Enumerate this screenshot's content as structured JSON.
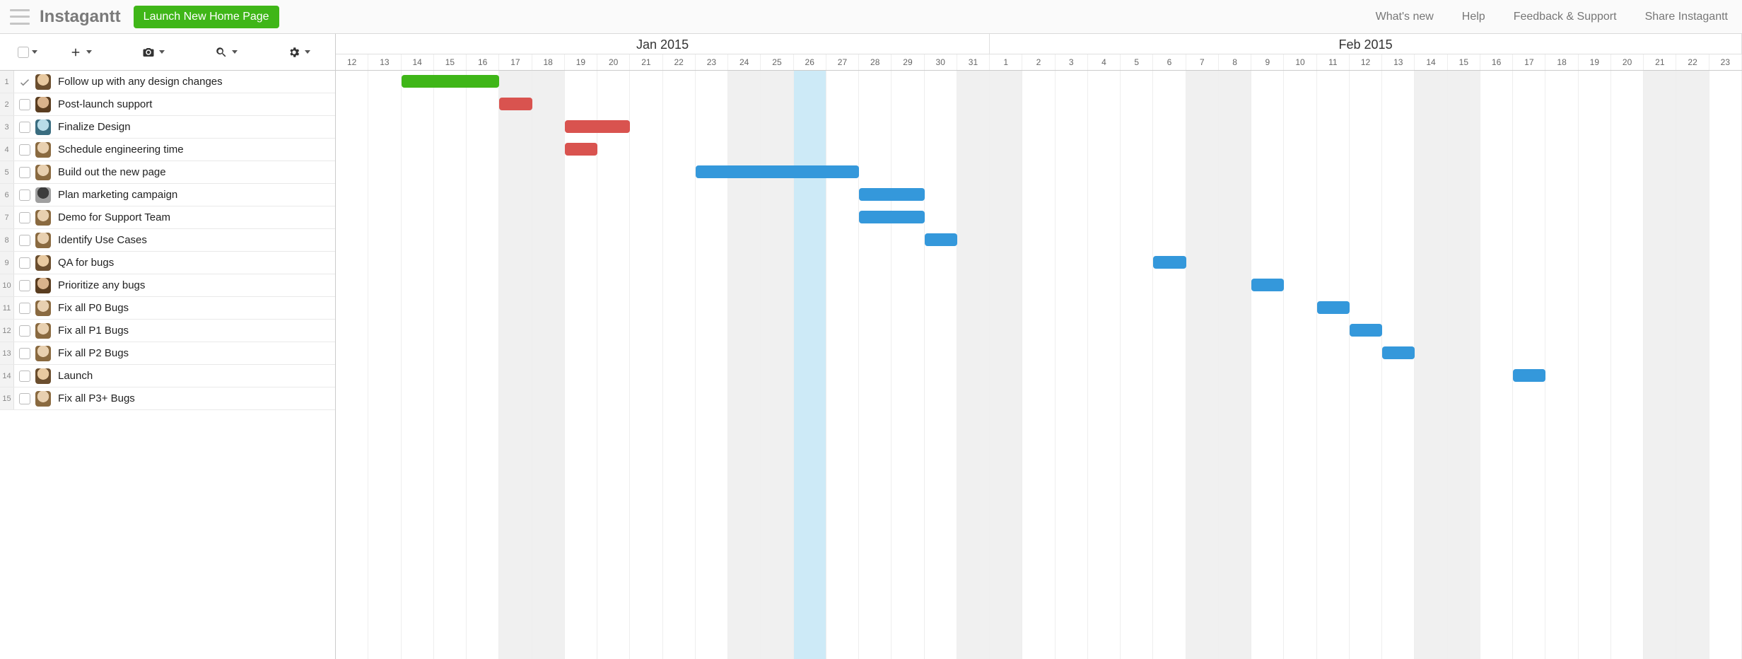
{
  "header": {
    "brand": "Instagantt",
    "project": "Launch New Home Page",
    "links": [
      "What's new",
      "Help",
      "Feedback & Support",
      "Share Instagantt"
    ]
  },
  "timeline": {
    "start_serial": 0,
    "total_days": 43,
    "today_index": 14,
    "months": [
      {
        "label": "Jan 2015",
        "span": 20
      },
      {
        "label": "Feb 2015",
        "span": 23
      }
    ],
    "days": [
      12,
      13,
      14,
      15,
      16,
      17,
      18,
      19,
      20,
      21,
      22,
      23,
      24,
      25,
      26,
      27,
      28,
      29,
      30,
      31,
      1,
      2,
      3,
      4,
      5,
      6,
      7,
      8,
      9,
      10,
      11,
      12,
      13,
      14,
      15,
      16,
      17,
      18,
      19,
      20,
      21,
      22,
      23
    ],
    "weekend_indices": [
      5,
      6,
      12,
      13,
      19,
      20,
      26,
      27,
      33,
      34,
      40,
      41
    ]
  },
  "tasks": [
    {
      "num": 1,
      "done": true,
      "avatar": "a1",
      "name": "Follow up with any design changes",
      "bar": {
        "start": 2,
        "span": 3,
        "color": "green"
      }
    },
    {
      "num": 2,
      "done": false,
      "avatar": "a2",
      "name": "Post-launch support",
      "bar": {
        "start": 5,
        "span": 1,
        "color": "red"
      }
    },
    {
      "num": 3,
      "done": false,
      "avatar": "a3",
      "name": "Finalize Design",
      "bar": {
        "start": 7,
        "span": 2,
        "color": "red"
      }
    },
    {
      "num": 4,
      "done": false,
      "avatar": "a4",
      "name": "Schedule engineering time",
      "bar": {
        "start": 7,
        "span": 1,
        "color": "red"
      }
    },
    {
      "num": 5,
      "done": false,
      "avatar": "a4",
      "name": "Build out the new page",
      "bar": {
        "start": 11,
        "span": 5,
        "color": "blue"
      }
    },
    {
      "num": 6,
      "done": false,
      "avatar": "a5",
      "name": "Plan marketing campaign",
      "bar": {
        "start": 16,
        "span": 2,
        "color": "blue"
      }
    },
    {
      "num": 7,
      "done": false,
      "avatar": "a4",
      "name": "Demo for Support Team",
      "bar": {
        "start": 16,
        "span": 2,
        "color": "blue"
      }
    },
    {
      "num": 8,
      "done": false,
      "avatar": "a4",
      "name": "Identify Use Cases",
      "bar": {
        "start": 18,
        "span": 1,
        "color": "blue"
      }
    },
    {
      "num": 9,
      "done": false,
      "avatar": "a1",
      "name": "QA for bugs",
      "bar": {
        "start": 25,
        "span": 1,
        "color": "blue"
      }
    },
    {
      "num": 10,
      "done": false,
      "avatar": "a2",
      "name": "Prioritize any bugs",
      "bar": {
        "start": 28,
        "span": 1,
        "color": "blue"
      }
    },
    {
      "num": 11,
      "done": false,
      "avatar": "a4",
      "name": "Fix all P0 Bugs",
      "bar": {
        "start": 30,
        "span": 1,
        "color": "blue"
      }
    },
    {
      "num": 12,
      "done": false,
      "avatar": "a4",
      "name": "Fix all P1 Bugs",
      "bar": {
        "start": 31,
        "span": 1,
        "color": "blue"
      }
    },
    {
      "num": 13,
      "done": false,
      "avatar": "a4",
      "name": "Fix all P2 Bugs",
      "bar": {
        "start": 32,
        "span": 1,
        "color": "blue"
      }
    },
    {
      "num": 14,
      "done": false,
      "avatar": "a1",
      "name": "Launch",
      "bar": {
        "start": 36,
        "span": 1,
        "color": "blue"
      }
    },
    {
      "num": 15,
      "done": false,
      "avatar": "a4",
      "name": "Fix all P3+ Bugs",
      "bar": null
    }
  ],
  "avatar_colors": {
    "a1": [
      "#e8c9a0",
      "#6b4e2e"
    ],
    "a2": [
      "#d9b38c",
      "#5a3d20"
    ],
    "a3": [
      "#b8dce8",
      "#3a6d80"
    ],
    "a4": [
      "#e8d0b0",
      "#8a6a40"
    ],
    "a5": [
      "#3c3c3c",
      "#a0a0a0"
    ]
  },
  "chart_data": {
    "type": "gantt",
    "title": "Launch New Home Page",
    "x_unit": "day",
    "x_range": [
      "2015-01-12",
      "2015-02-23"
    ],
    "today": "2015-01-26",
    "series": [
      {
        "name": "Follow up with any design changes",
        "start": "2015-01-14",
        "end": "2015-01-16",
        "status": "green"
      },
      {
        "name": "Post-launch support",
        "start": "2015-01-17",
        "end": "2015-01-17",
        "status": "red"
      },
      {
        "name": "Finalize Design",
        "start": "2015-01-19",
        "end": "2015-01-20",
        "status": "red"
      },
      {
        "name": "Schedule engineering time",
        "start": "2015-01-19",
        "end": "2015-01-19",
        "status": "red"
      },
      {
        "name": "Build out the new page",
        "start": "2015-01-23",
        "end": "2015-01-27",
        "status": "blue"
      },
      {
        "name": "Plan marketing campaign",
        "start": "2015-01-28",
        "end": "2015-01-29",
        "status": "blue"
      },
      {
        "name": "Demo for Support Team",
        "start": "2015-01-28",
        "end": "2015-01-29",
        "status": "blue"
      },
      {
        "name": "Identify Use Cases",
        "start": "2015-01-30",
        "end": "2015-01-30",
        "status": "blue"
      },
      {
        "name": "QA for bugs",
        "start": "2015-02-06",
        "end": "2015-02-06",
        "status": "blue"
      },
      {
        "name": "Prioritize any bugs",
        "start": "2015-02-09",
        "end": "2015-02-09",
        "status": "blue"
      },
      {
        "name": "Fix all P0 Bugs",
        "start": "2015-02-11",
        "end": "2015-02-11",
        "status": "blue"
      },
      {
        "name": "Fix all P1 Bugs",
        "start": "2015-02-12",
        "end": "2015-02-12",
        "status": "blue"
      },
      {
        "name": "Fix all P2 Bugs",
        "start": "2015-02-13",
        "end": "2015-02-13",
        "status": "blue"
      },
      {
        "name": "Launch",
        "start": "2015-02-17",
        "end": "2015-02-17",
        "status": "blue"
      },
      {
        "name": "Fix all P3+ Bugs",
        "start": null,
        "end": null,
        "status": null
      }
    ]
  }
}
